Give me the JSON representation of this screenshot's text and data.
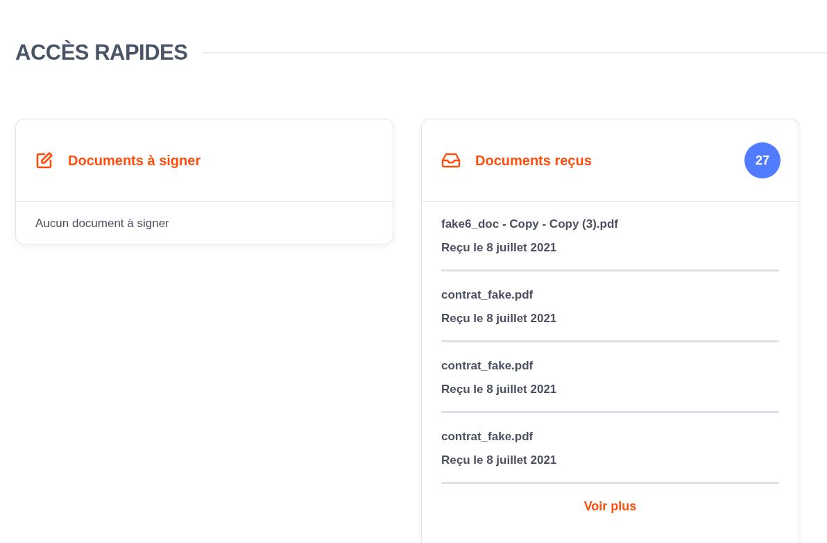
{
  "section_title": "ACCÈS RAPIDES",
  "cards": [
    {
      "kind": "empty",
      "title": "Documents à signer",
      "empty_text": "Aucun document à signer"
    },
    {
      "kind": "list",
      "title": "Documents reçus",
      "badge": "27",
      "documents": [
        {
          "name": "fake6_doc - Copy - Copy (3).pdf",
          "received": "Reçu le 8 juillet 2021"
        },
        {
          "name": "contrat_fake.pdf",
          "received": "Reçu le 8 juillet 2021"
        },
        {
          "name": "contrat_fake.pdf",
          "received": "Reçu le 8 juillet 2021"
        },
        {
          "name": "contrat_fake.pdf",
          "received": "Reçu le 8 juillet 2021"
        }
      ],
      "more_link": "Voir plus"
    }
  ]
}
